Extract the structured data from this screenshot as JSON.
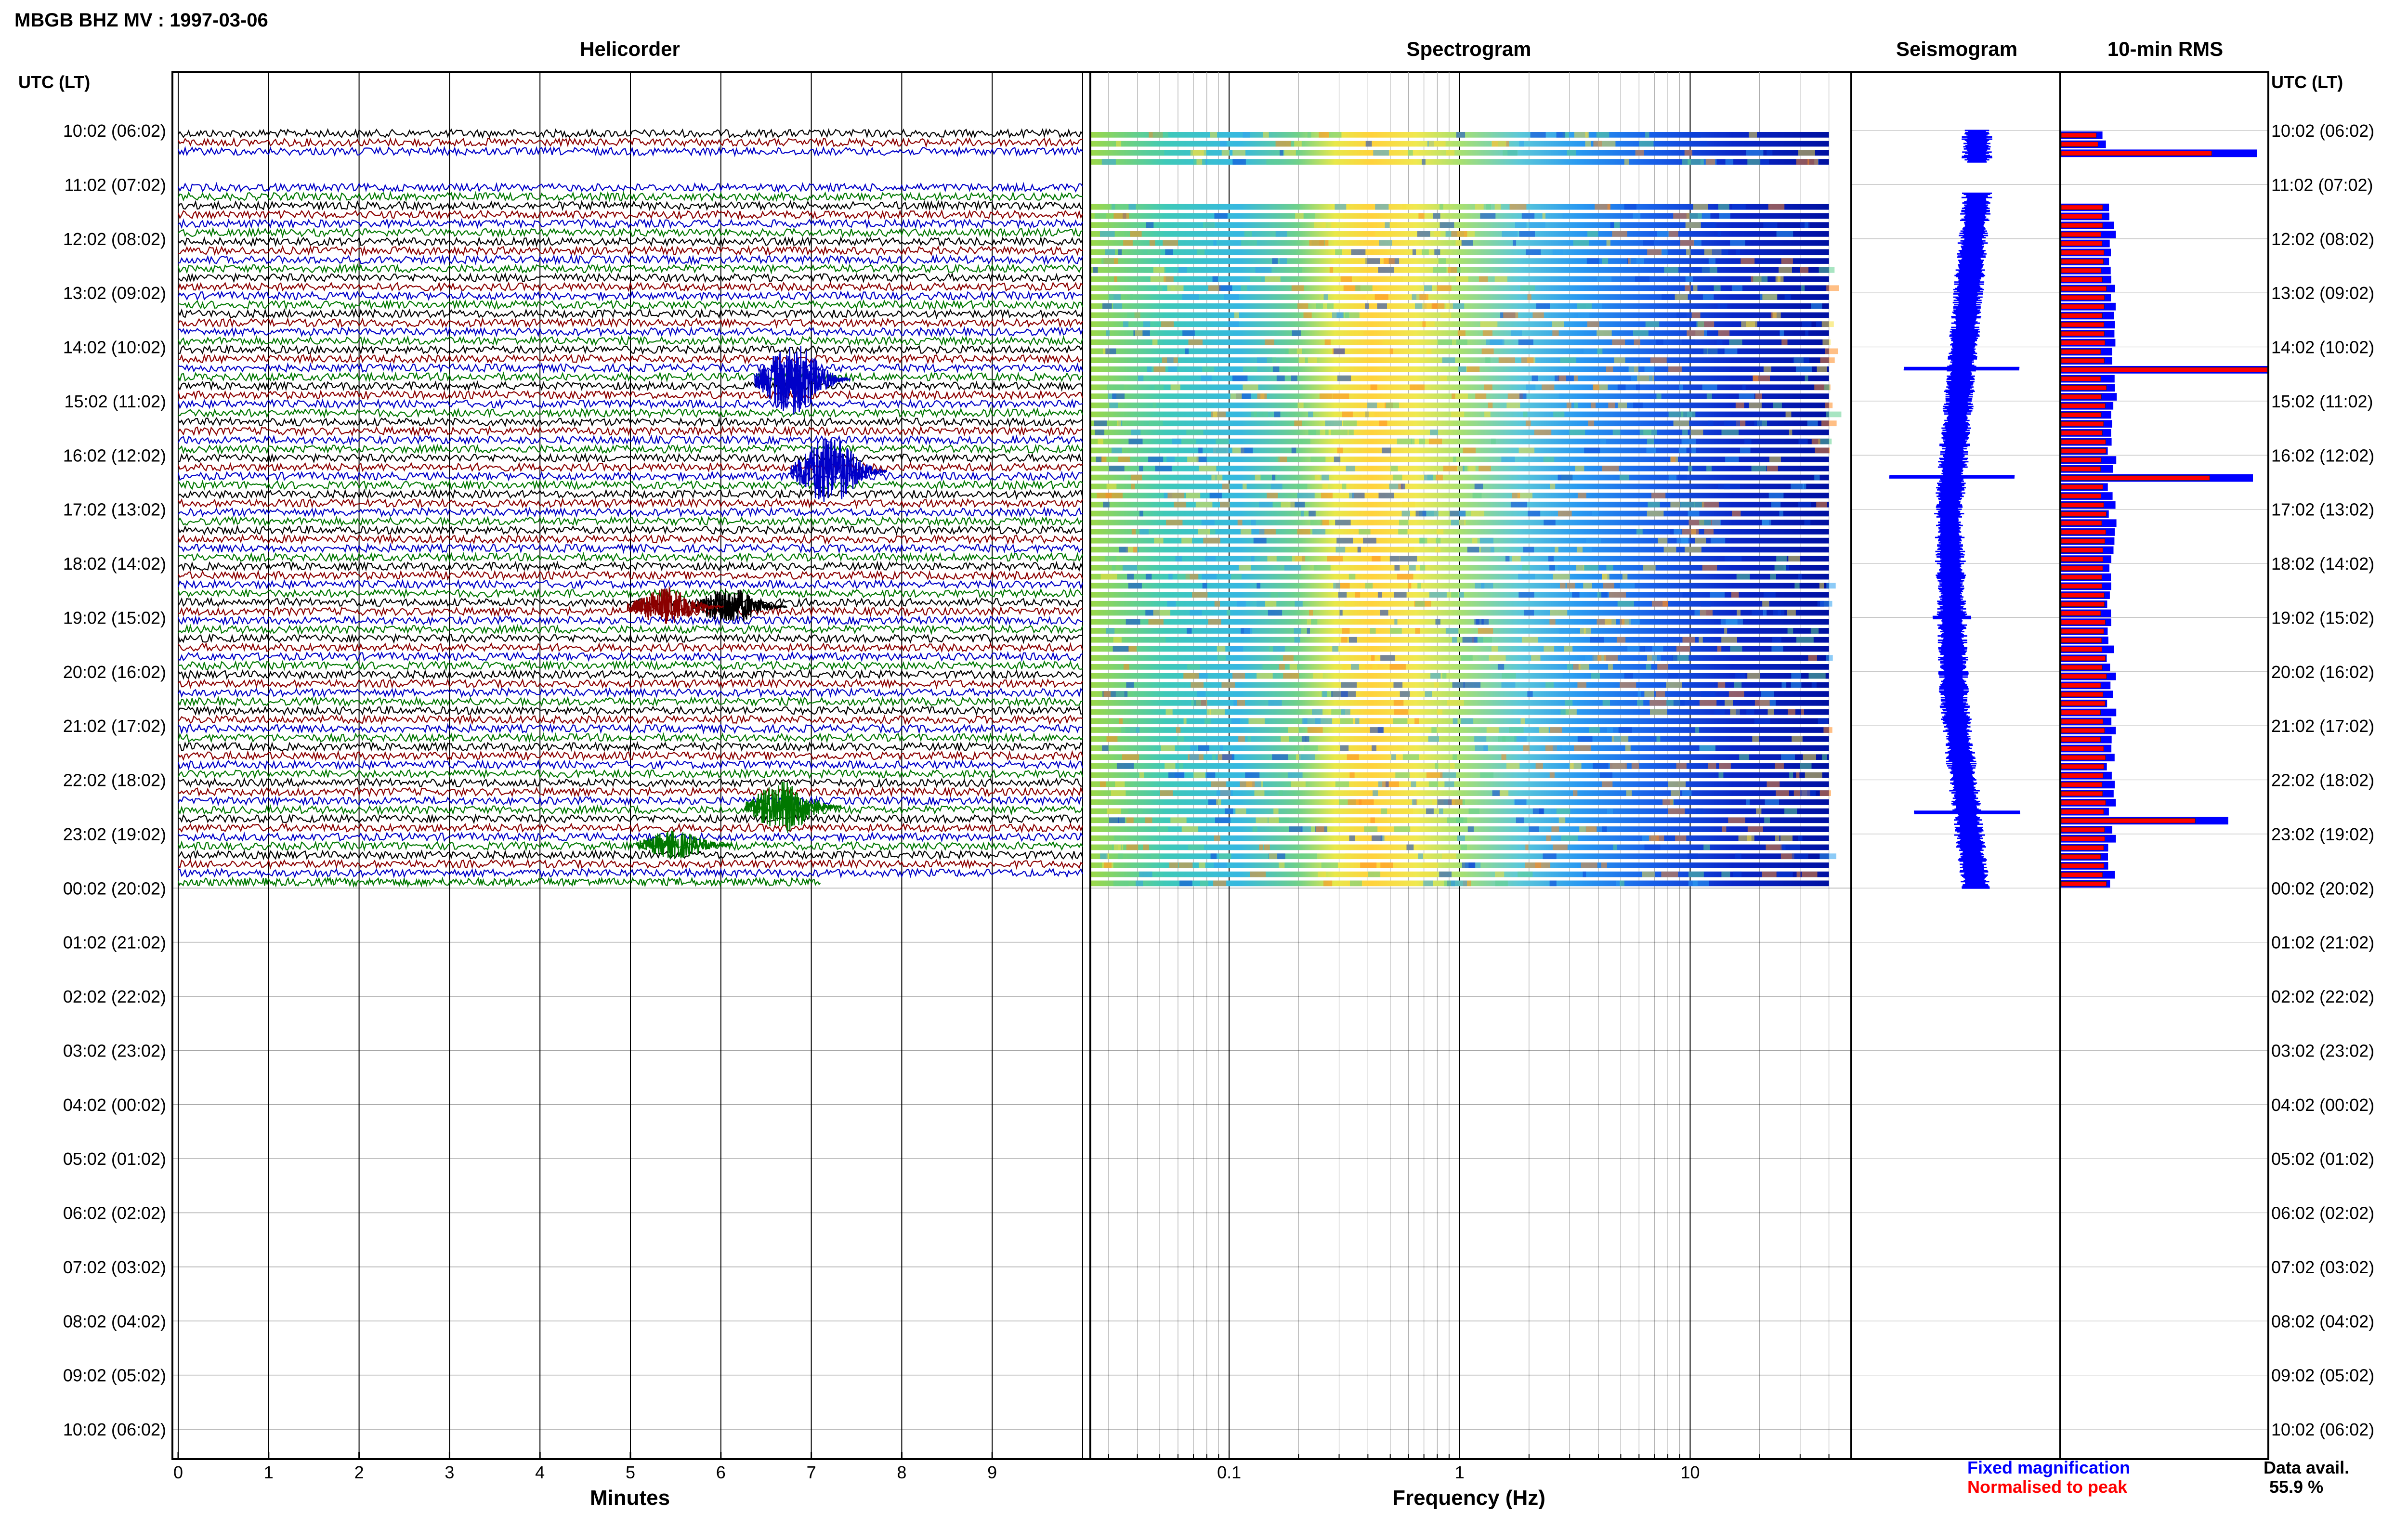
{
  "page": {
    "title": "MBGB BHZ MV : 1997-03-06",
    "utc_header_left": "UTC (LT)",
    "utc_header_right": "UTC (LT)"
  },
  "colors": {
    "trace_cycle": [
      "#000000",
      "#8b0000",
      "#0000c8",
      "#007800"
    ],
    "rms_fixed": "#0000ff",
    "rms_normalised": "#ff0000",
    "seismogram": "#0000ff"
  },
  "time_labels": [
    "10:02 (06:02)",
    "11:02 (07:02)",
    "12:02 (08:02)",
    "13:02 (09:02)",
    "14:02 (10:02)",
    "15:02 (11:02)",
    "16:02 (12:02)",
    "17:02 (13:02)",
    "18:02 (14:02)",
    "19:02 (15:02)",
    "20:02 (16:02)",
    "21:02 (17:02)",
    "22:02 (18:02)",
    "23:02 (19:02)",
    "00:02 (20:02)",
    "01:02 (21:02)",
    "02:02 (22:02)",
    "03:02 (23:02)",
    "04:02 (00:02)",
    "05:02 (01:02)",
    "06:02 (02:02)",
    "07:02 (03:02)",
    "08:02 (04:02)",
    "09:02 (05:02)",
    "10:02 (06:02)"
  ],
  "chart_data": [
    {
      "type": "line",
      "title": "Helicorder",
      "xlabel": "Minutes",
      "x_ticks": [
        "0",
        "1",
        "2",
        "3",
        "4",
        "5",
        "6",
        "7",
        "8",
        "9"
      ],
      "xlim": [
        0,
        10
      ],
      "rows_per_hour": 6,
      "data_hours": [
        0,
        14
      ],
      "gap_hours": [
        0.5,
        1.0
      ],
      "events": [
        {
          "hour_row": 4.6,
          "minute": 6.9,
          "amplitude": 3.0,
          "color": "#0000c8"
        },
        {
          "hour_row": 6.3,
          "minute": 7.3,
          "amplitude": 3.0,
          "color": "#0000c8"
        },
        {
          "hour_row": 8.8,
          "minute": 6.2,
          "amplitude": 1.6,
          "color": "#000000"
        },
        {
          "hour_row": 8.8,
          "minute": 5.5,
          "amplitude": 1.6,
          "color": "#8b0000"
        },
        {
          "hour_row": 12.5,
          "minute": 6.8,
          "amplitude": 2.2,
          "color": "#007800"
        },
        {
          "hour_row": 13.2,
          "minute": 5.6,
          "amplitude": 1.2,
          "color": "#007800"
        }
      ]
    },
    {
      "type": "heatmap",
      "title": "Spectrogram",
      "xlabel": "Frequency (Hz)",
      "x_scale": "log",
      "xlim": [
        0.025,
        50
      ],
      "x_ticks": [
        "0.1",
        "1",
        "10"
      ],
      "data_hours": [
        0,
        14
      ],
      "gap_hours": [
        0.65,
        1.2
      ],
      "colormap": "jet",
      "data_freq_max": 40
    },
    {
      "type": "line",
      "title": "Seismogram",
      "data_hours": [
        0,
        14
      ],
      "gap_hours": [
        0.6,
        1.15
      ]
    },
    {
      "type": "bar",
      "title": "10-min RMS",
      "orientation": "horizontal",
      "data_hours": [
        0,
        14
      ],
      "gap_hours": [
        0.45,
        1.2
      ],
      "series": [
        {
          "name": "Fixed magnification",
          "color": "#0000ff"
        },
        {
          "name": "Normalised to peak",
          "color": "#ff0000"
        }
      ],
      "spikes": [
        {
          "hour": 0.4,
          "fixed": 0.95,
          "normalised": 0.73
        },
        {
          "hour": 4.4,
          "fixed": 1.0,
          "normalised": 1.0
        },
        {
          "hour": 6.4,
          "fixed": 0.93,
          "normalised": 0.72
        },
        {
          "hour": 12.6,
          "fixed": 0.81,
          "normalised": 0.65
        }
      ],
      "data_availability_label": "Data avail.",
      "data_availability_value": "55.9 %"
    }
  ]
}
